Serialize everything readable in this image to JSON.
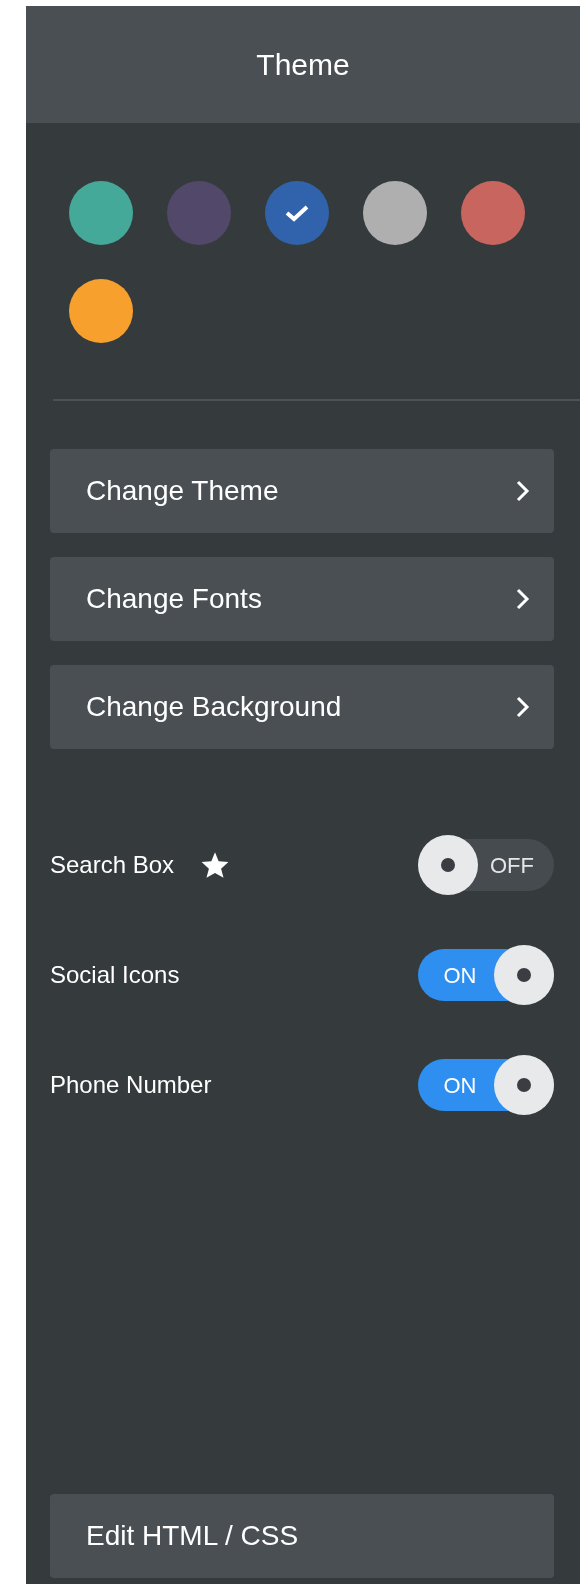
{
  "header": {
    "title": "Theme"
  },
  "swatches": [
    {
      "color": "#44a999",
      "selected": false
    },
    {
      "color": "#524869",
      "selected": false
    },
    {
      "color": "#3163ad",
      "selected": true
    },
    {
      "color": "#afafaf",
      "selected": false
    },
    {
      "color": "#c9655f",
      "selected": false
    },
    {
      "color": "#f8a02e",
      "selected": false
    }
  ],
  "menu": [
    {
      "label": "Change Theme"
    },
    {
      "label": "Change Fonts"
    },
    {
      "label": "Change Background"
    }
  ],
  "toggles": [
    {
      "label": "Search Box",
      "starred": true,
      "on": false,
      "state_text": "OFF"
    },
    {
      "label": "Social Icons",
      "starred": false,
      "on": true,
      "state_text": "ON"
    },
    {
      "label": "Phone Number",
      "starred": false,
      "on": true,
      "state_text": "ON"
    }
  ],
  "footer_button": {
    "label": "Edit HTML / CSS"
  }
}
